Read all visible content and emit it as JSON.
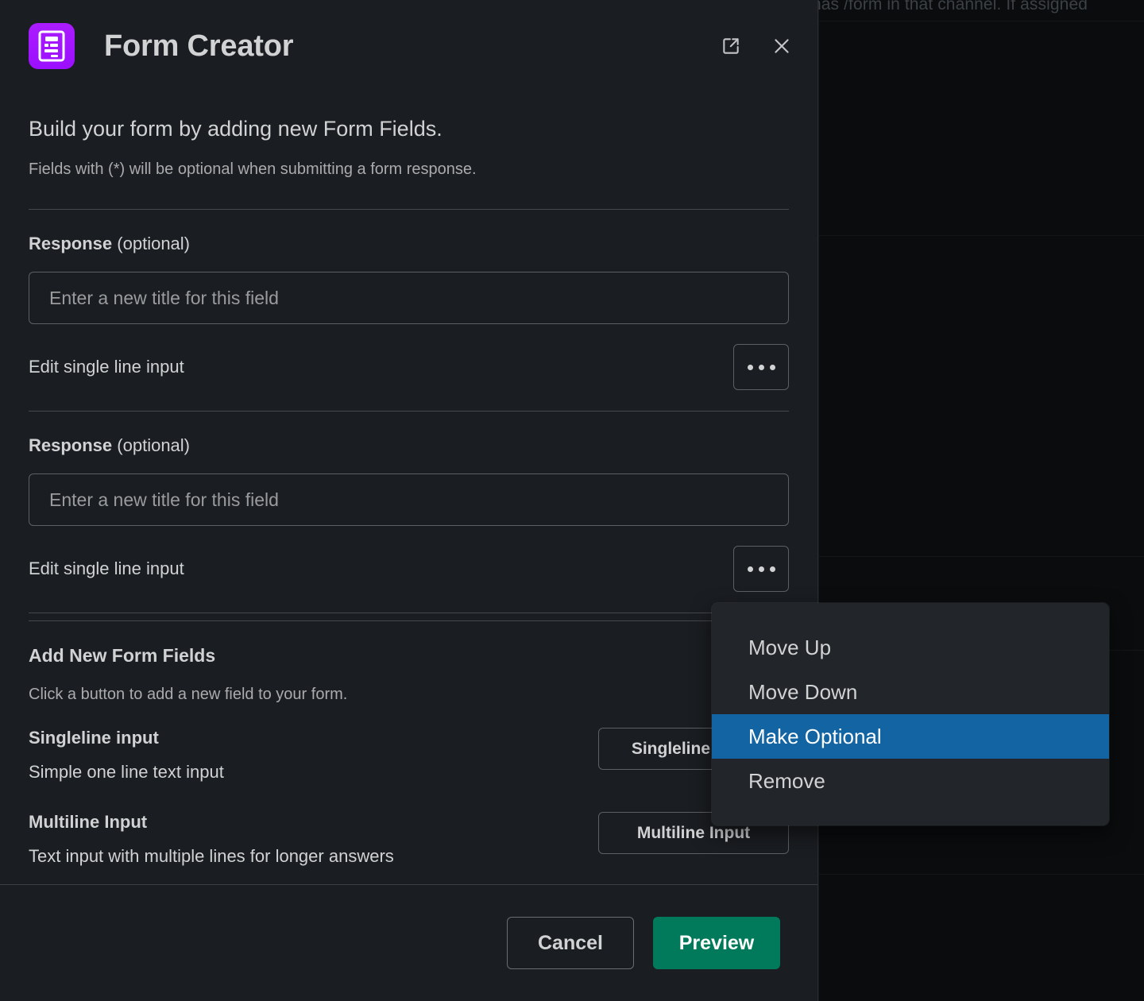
{
  "backdrop": {
    "partial_text": "has /form in that channel. If assigned"
  },
  "modal": {
    "title": "Form Creator",
    "app_icon": "form-document-icon",
    "icon_color": "#a41bff",
    "header_actions": [
      {
        "name": "open-in-new-window",
        "icon": "external-link-icon"
      },
      {
        "name": "close-dialog",
        "icon": "close-icon"
      }
    ],
    "intro": {
      "title": "Build your form by adding new Form Fields.",
      "subtitle": "Fields with (*) will be optional when submitting a form response."
    },
    "fields": [
      {
        "label_strong": "Response",
        "label_optional": "(optional)",
        "input_placeholder": "Enter a new title for this field",
        "input_value": "",
        "row_text": "Edit single line input",
        "overflow_icon": "ellipsis-icon"
      },
      {
        "label_strong": "Response",
        "label_optional": "(optional)",
        "input_placeholder": "Enter a new title for this field",
        "input_value": "",
        "row_text": "Edit single line input",
        "overflow_icon": "ellipsis-icon"
      }
    ],
    "add_section": {
      "heading": "Add New Form Fields",
      "subtitle": "Click a button to add a new field to your form.",
      "options": [
        {
          "title": "Singleline input",
          "description": "Simple one line text input",
          "button_label": "Singleline Input"
        },
        {
          "title": "Multiline Input",
          "description": "Text input with multiple lines for longer answers",
          "button_label": "Multiline Input"
        }
      ]
    },
    "footer": {
      "cancel_label": "Cancel",
      "preview_label": "Preview",
      "preview_color": "#007a5a"
    }
  },
  "context_menu": {
    "highlight_color": "#1264a3",
    "items": [
      {
        "label": "Move Up",
        "selected": false
      },
      {
        "label": "Move Down",
        "selected": false
      },
      {
        "label": "Make Optional",
        "selected": true
      },
      {
        "label": "Remove",
        "selected": false
      }
    ]
  }
}
